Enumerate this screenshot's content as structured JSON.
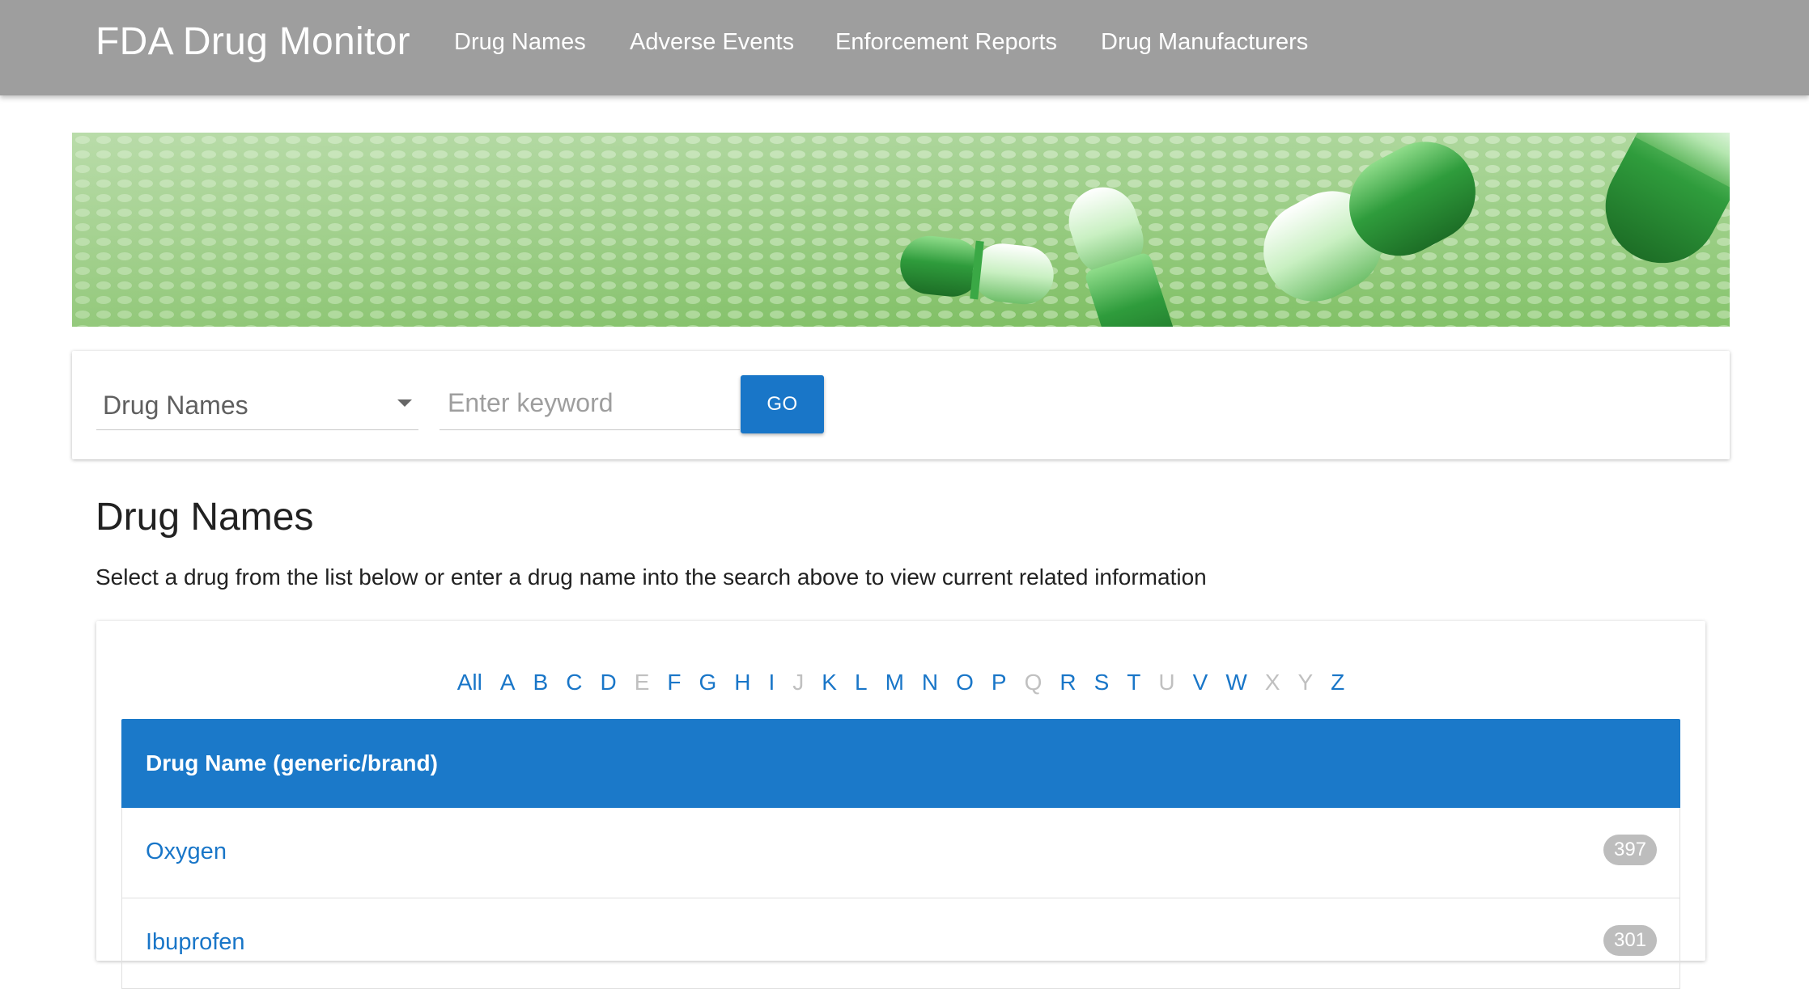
{
  "navbar": {
    "brand": "FDA Drug Monitor",
    "links": [
      "Drug Names",
      "Adverse Events",
      "Enforcement Reports",
      "Drug Manufacturers"
    ]
  },
  "search": {
    "selected_type": "Drug Names",
    "placeholder": "Enter keyword",
    "value": "",
    "go_label": "GO"
  },
  "main": {
    "title": "Drug Names",
    "description": "Select a drug from the list below or enter a drug name into the search above to view current related information"
  },
  "alphabet": [
    {
      "label": "All",
      "enabled": true
    },
    {
      "label": "A",
      "enabled": true
    },
    {
      "label": "B",
      "enabled": true
    },
    {
      "label": "C",
      "enabled": true
    },
    {
      "label": "D",
      "enabled": true
    },
    {
      "label": "E",
      "enabled": false
    },
    {
      "label": "F",
      "enabled": true
    },
    {
      "label": "G",
      "enabled": true
    },
    {
      "label": "H",
      "enabled": true
    },
    {
      "label": "I",
      "enabled": true
    },
    {
      "label": "J",
      "enabled": false
    },
    {
      "label": "K",
      "enabled": true
    },
    {
      "label": "L",
      "enabled": true
    },
    {
      "label": "M",
      "enabled": true
    },
    {
      "label": "N",
      "enabled": true
    },
    {
      "label": "O",
      "enabled": true
    },
    {
      "label": "P",
      "enabled": true
    },
    {
      "label": "Q",
      "enabled": false
    },
    {
      "label": "R",
      "enabled": true
    },
    {
      "label": "S",
      "enabled": true
    },
    {
      "label": "T",
      "enabled": true
    },
    {
      "label": "U",
      "enabled": false
    },
    {
      "label": "V",
      "enabled": true
    },
    {
      "label": "W",
      "enabled": true
    },
    {
      "label": "X",
      "enabled": false
    },
    {
      "label": "Y",
      "enabled": false
    },
    {
      "label": "Z",
      "enabled": true
    }
  ],
  "table": {
    "header": "Drug Name (generic/brand)",
    "rows": [
      {
        "name": "Oxygen",
        "count": "397"
      },
      {
        "name": "Ibuprofen",
        "count": "301"
      }
    ]
  },
  "colors": {
    "navbar": "#9e9e9e",
    "accent": "#1976c8",
    "badge": "#bdbdbd",
    "banner_green": "#7fbf64"
  }
}
